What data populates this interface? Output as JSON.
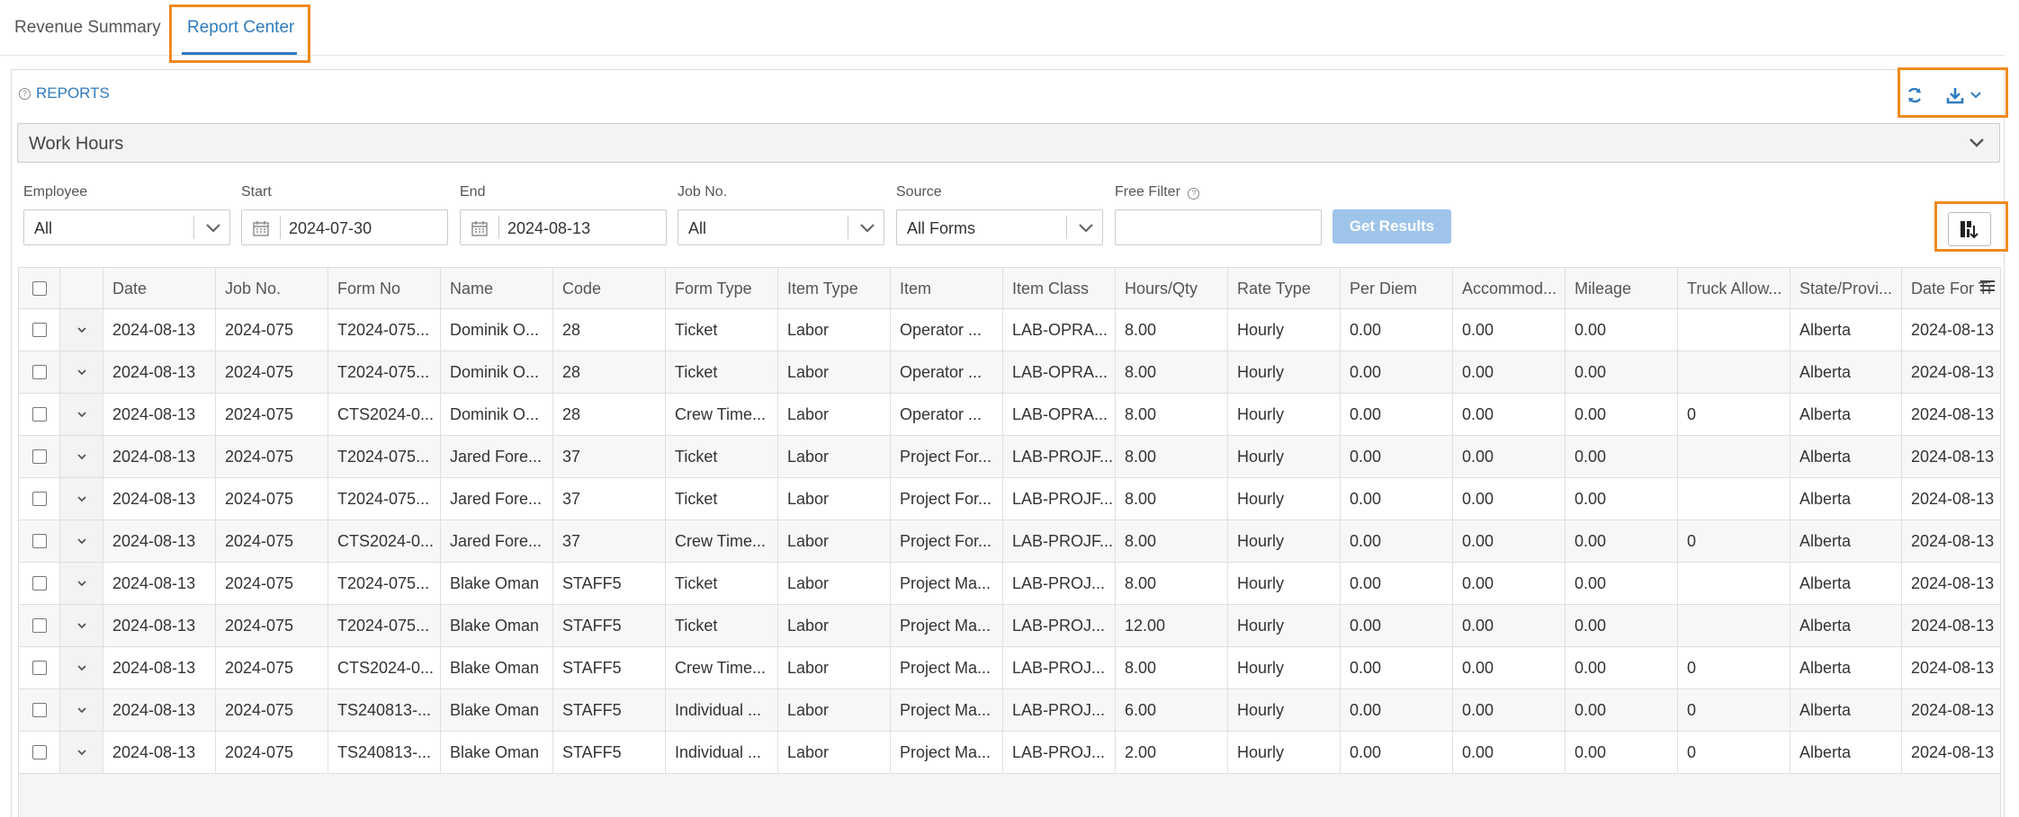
{
  "tabs": [
    {
      "label": "Revenue Summary"
    },
    {
      "label": "Report Center"
    }
  ],
  "panel": {
    "title": "REPORTS",
    "report_select": "Work Hours"
  },
  "filters": {
    "employee": {
      "label": "Employee",
      "value": "All"
    },
    "start": {
      "label": "Start",
      "value": "2024-07-30"
    },
    "end": {
      "label": "End",
      "value": "2024-08-13"
    },
    "job": {
      "label": "Job No.",
      "value": "All"
    },
    "source": {
      "label": "Source",
      "value": "All Forms"
    },
    "free": {
      "label": "Free Filter",
      "value": ""
    },
    "get_results": "Get Results"
  },
  "table": {
    "columns": [
      "Date",
      "Job No.",
      "Form No",
      "Name",
      "Code",
      "Form Type",
      "Item Type",
      "Item",
      "Item Class",
      "Hours/Qty",
      "Rate Type",
      "Per Diem",
      "Accommod...",
      "Mileage",
      "Truck Allow...",
      "State/Provi...",
      "Date For Ti"
    ],
    "rows": [
      [
        "2024-08-13",
        "2024-075",
        "T2024-075...",
        "Dominik O...",
        "28",
        "Ticket",
        "Labor",
        "Operator ...",
        "LAB-OPRA...",
        "8.00",
        "Hourly",
        "0.00",
        "0.00",
        "0.00",
        "",
        "Alberta",
        "2024-08-13"
      ],
      [
        "2024-08-13",
        "2024-075",
        "T2024-075...",
        "Dominik O...",
        "28",
        "Ticket",
        "Labor",
        "Operator ...",
        "LAB-OPRA...",
        "8.00",
        "Hourly",
        "0.00",
        "0.00",
        "0.00",
        "",
        "Alberta",
        "2024-08-13"
      ],
      [
        "2024-08-13",
        "2024-075",
        "CTS2024-0...",
        "Dominik O...",
        "28",
        "Crew Time...",
        "Labor",
        "Operator ...",
        "LAB-OPRA...",
        "8.00",
        "Hourly",
        "0.00",
        "0.00",
        "0.00",
        "0",
        "Alberta",
        "2024-08-13"
      ],
      [
        "2024-08-13",
        "2024-075",
        "T2024-075...",
        "Jared Fore...",
        "37",
        "Ticket",
        "Labor",
        "Project For...",
        "LAB-PROJF...",
        "8.00",
        "Hourly",
        "0.00",
        "0.00",
        "0.00",
        "",
        "Alberta",
        "2024-08-13"
      ],
      [
        "2024-08-13",
        "2024-075",
        "T2024-075...",
        "Jared Fore...",
        "37",
        "Ticket",
        "Labor",
        "Project For...",
        "LAB-PROJF...",
        "8.00",
        "Hourly",
        "0.00",
        "0.00",
        "0.00",
        "",
        "Alberta",
        "2024-08-13"
      ],
      [
        "2024-08-13",
        "2024-075",
        "CTS2024-0...",
        "Jared Fore...",
        "37",
        "Crew Time...",
        "Labor",
        "Project For...",
        "LAB-PROJF...",
        "8.00",
        "Hourly",
        "0.00",
        "0.00",
        "0.00",
        "0",
        "Alberta",
        "2024-08-13"
      ],
      [
        "2024-08-13",
        "2024-075",
        "T2024-075...",
        "Blake Oman",
        "STAFF5",
        "Ticket",
        "Labor",
        "Project Ma...",
        "LAB-PROJ...",
        "8.00",
        "Hourly",
        "0.00",
        "0.00",
        "0.00",
        "",
        "Alberta",
        "2024-08-13"
      ],
      [
        "2024-08-13",
        "2024-075",
        "T2024-075...",
        "Blake Oman",
        "STAFF5",
        "Ticket",
        "Labor",
        "Project Ma...",
        "LAB-PROJ...",
        "12.00",
        "Hourly",
        "0.00",
        "0.00",
        "0.00",
        "",
        "Alberta",
        "2024-08-13"
      ],
      [
        "2024-08-13",
        "2024-075",
        "CTS2024-0...",
        "Blake Oman",
        "STAFF5",
        "Crew Time...",
        "Labor",
        "Project Ma...",
        "LAB-PROJ...",
        "8.00",
        "Hourly",
        "0.00",
        "0.00",
        "0.00",
        "0",
        "Alberta",
        "2024-08-13"
      ],
      [
        "2024-08-13",
        "2024-075",
        "TS240813-...",
        "Blake Oman",
        "STAFF5",
        "Individual ...",
        "Labor",
        "Project Ma...",
        "LAB-PROJ...",
        "6.00",
        "Hourly",
        "0.00",
        "0.00",
        "0.00",
        "0",
        "Alberta",
        "2024-08-13"
      ],
      [
        "2024-08-13",
        "2024-075",
        "TS240813-...",
        "Blake Oman",
        "STAFF5",
        "Individual ...",
        "Labor",
        "Project Ma...",
        "LAB-PROJ...",
        "2.00",
        "Hourly",
        "0.00",
        "0.00",
        "0.00",
        "0",
        "Alberta",
        "2024-08-13"
      ]
    ]
  },
  "colors": {
    "accent": "#2f7bbf",
    "highlight": "#ee8a1c",
    "button_disabled": "#9ec4ea"
  },
  "icons": {
    "refresh": "refresh-icon",
    "download": "download-icon",
    "column_chooser": "column-chooser-icon",
    "calendar": "calendar-icon",
    "menu": "menu-icon"
  }
}
